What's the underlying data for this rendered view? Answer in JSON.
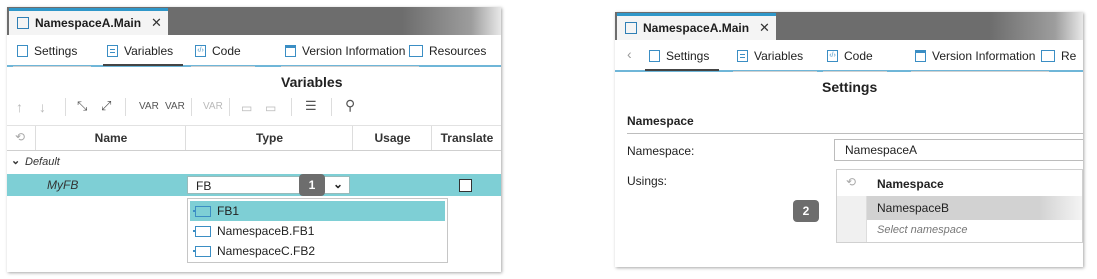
{
  "left": {
    "tab_title": "NamespaceA.Main",
    "tab_close": "✕",
    "subtabs": [
      "Settings",
      "Variables",
      "Code",
      "Version Information",
      "Resources"
    ],
    "heading": "Variables",
    "toolbar_var1": "VAR",
    "toolbar_var2": "VAR",
    "toolbar_var3": "VAR",
    "columns": [
      "Name",
      "Type",
      "Usage",
      "Translate"
    ],
    "group": "Default",
    "row_name": "MyFB",
    "combo_value": "FB",
    "dropdown_items": [
      "FB1",
      "NamespaceB.FB1",
      "NamespaceC.FB2"
    ],
    "badge": "1"
  },
  "right": {
    "tab_title": "NamespaceA.Main",
    "tab_close": "✕",
    "subtabs": [
      "Settings",
      "Variables",
      "Code",
      "Version Information",
      "Re"
    ],
    "heading": "Settings",
    "section": "Namespace",
    "namespace_label": "Namespace:",
    "namespace_value": "NamespaceA",
    "usings_label": "Usings:",
    "table_header": "Namespace",
    "row1": "NamespaceB",
    "row2_placeholder": "Select namespace",
    "badge": "2"
  },
  "colors": {
    "accent": "#2f97c9",
    "selection": "#7ecfd5",
    "badge": "#6d6d6d"
  }
}
